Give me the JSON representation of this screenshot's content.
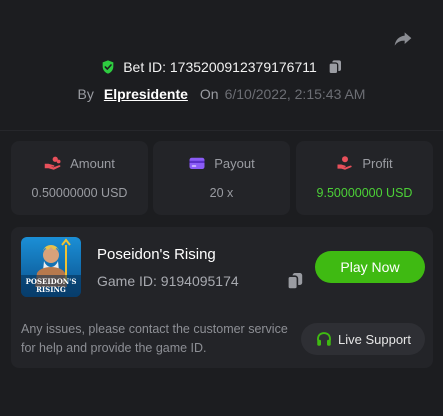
{
  "header": {
    "bet_id_label": "Bet ID: 1735200912379176711",
    "by_label": "By",
    "username": "Elpresidente",
    "on_label": "On",
    "timestamp": "6/10/2022, 2:15:43 AM"
  },
  "stats": [
    {
      "title": "Amount",
      "value": "0.50000000 USD",
      "icon": "coins-hand-icon",
      "icon_color": "#e8505b"
    },
    {
      "title": "Payout",
      "value": "20 x",
      "icon": "card-icon",
      "icon_color": "#8b5cf6"
    },
    {
      "title": "Profit",
      "value": "9.50000000 USD",
      "icon": "profit-hand-icon",
      "icon_color": "#e8505b",
      "value_color": "#4cd137"
    }
  ],
  "game": {
    "name": "Poseidon's Rising",
    "id_label": "Game ID: 9194095174",
    "thumb_caption": "POSEIDON'S RISING",
    "play_label": "Play Now"
  },
  "support": {
    "message": "Any issues, please contact the customer service for help and provide the game ID.",
    "button_label": "Live Support"
  },
  "colors": {
    "background": "#1c1d20",
    "panel": "#232428",
    "accent_green": "#3fba12",
    "profit_green": "#4cd137",
    "shield_green": "#2ecc40"
  }
}
